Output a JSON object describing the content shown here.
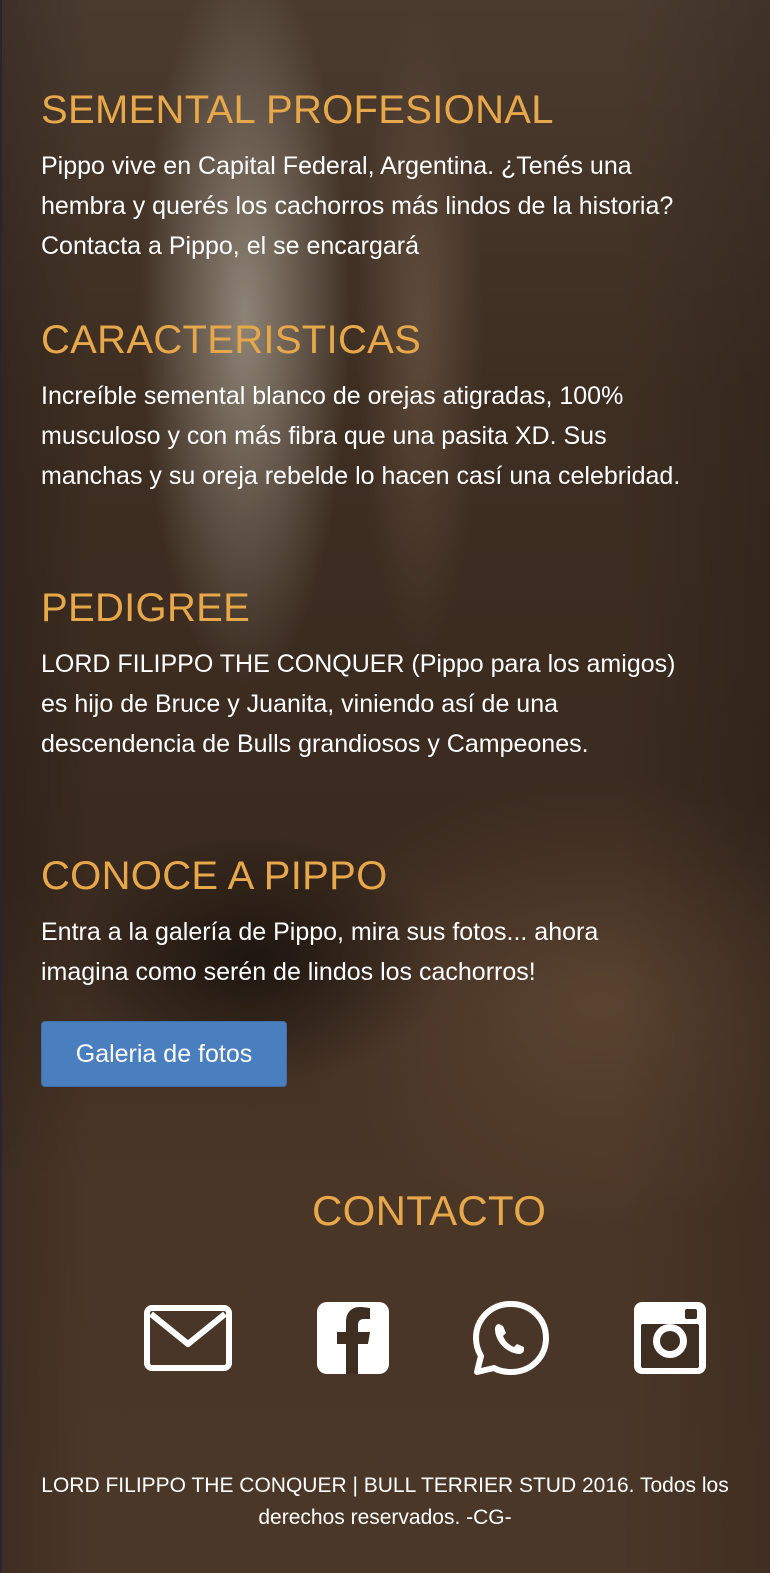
{
  "sections": [
    {
      "title": "SEMENTAL PROFESIONAL",
      "body": "Pippo vive en Capital Federal, Argentina. ¿Tenés una hembra y querés los cachorros más lindos de la historia? Contacta a Pippo, el se encargará"
    },
    {
      "title": "CARACTERISTICAS",
      "body": "Increíble semental blanco de orejas atigradas, 100% musculoso y con más fibra que una pasita XD. Sus manchas y su oreja rebelde lo hacen casí una celebridad."
    },
    {
      "title": "PEDIGREE",
      "body": "LORD FILIPPO THE CONQUER (Pippo para los amigos) es hijo de Bruce y Juanita, viniendo así de una descendencia de Bulls grandiosos y Campeones."
    },
    {
      "title": "CONOCE A PIPPO",
      "body": "Entra a la galería de Pippo, mira sus fotos... ahora imagina como serén de lindos los cachorros!"
    }
  ],
  "gallery_button": {
    "label": "Galeria de fotos",
    "color": "#4a7fbf"
  },
  "contact": {
    "title": "CONTACTO",
    "icons": [
      "envelope-icon",
      "facebook-icon",
      "whatsapp-icon",
      "instagram-icon"
    ]
  },
  "footer": {
    "text": "LORD FILIPPO THE CONQUER | BULL TERRIER STUD 2016. Todos los derechos reservados. -CG-"
  },
  "colors": {
    "heading": "#e7a74b",
    "text": "#ffffff"
  }
}
